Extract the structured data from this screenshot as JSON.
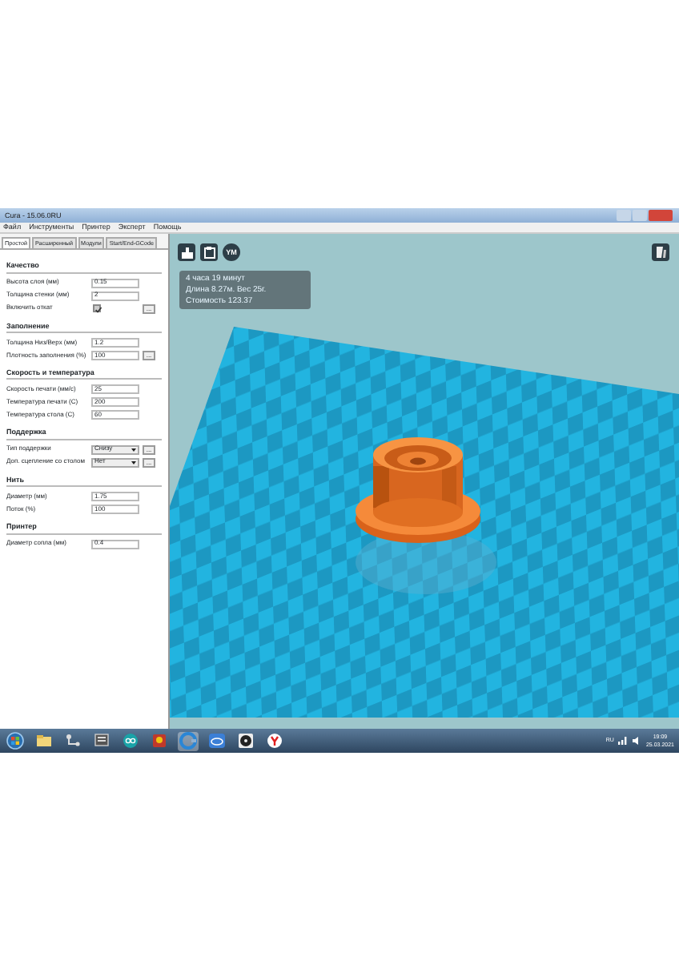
{
  "window": {
    "title": "Cura - 15.06.0RU"
  },
  "menu": [
    "Файл",
    "Инструменты",
    "Принтер",
    "Эксперт",
    "Помощь"
  ],
  "tabs": [
    {
      "label": "Простой",
      "selected": true
    },
    {
      "label": "Расширенный",
      "selected": false
    },
    {
      "label": "Модули",
      "selected": false
    },
    {
      "label": "Start/End-GCode",
      "selected": false
    }
  ],
  "sections": [
    {
      "title": "Качество",
      "fields": [
        {
          "kind": "text",
          "label": "Высота слоя (мм)",
          "value": "0.15"
        },
        {
          "kind": "text",
          "label": "Толщина стенки (мм)",
          "value": "2"
        },
        {
          "kind": "check",
          "label": "Включить откат",
          "checked": true,
          "button": "..."
        }
      ]
    },
    {
      "title": "Заполнение",
      "fields": [
        {
          "kind": "text",
          "label": "Толщина Низ/Верх (мм)",
          "value": "1.2"
        },
        {
          "kind": "text",
          "label": "Плотность заполнения (%)",
          "value": "100",
          "button": "..."
        }
      ]
    },
    {
      "title": "Скорость и температура",
      "fields": [
        {
          "kind": "text",
          "label": "Скорость печати (мм/с)",
          "value": "25"
        },
        {
          "kind": "text",
          "label": "Температура печати (C)",
          "value": "200"
        },
        {
          "kind": "text",
          "label": "Температура стола (C)",
          "value": "60"
        }
      ]
    },
    {
      "title": "Поддержка",
      "fields": [
        {
          "kind": "select",
          "label": "Тип поддержки",
          "value": "Снизу",
          "button": "..."
        },
        {
          "kind": "select",
          "label": "Доп. сцепление со столом",
          "value": "Нет",
          "button": "..."
        }
      ]
    },
    {
      "title": "Нить",
      "fields": [
        {
          "kind": "text",
          "label": "Диаметр (мм)",
          "value": "1.75"
        },
        {
          "kind": "text",
          "label": "Поток (%)",
          "value": "100"
        }
      ]
    },
    {
      "title": "Принтер",
      "fields": [
        {
          "kind": "text",
          "label": "Диаметр сопла (мм)",
          "value": "0.4"
        }
      ]
    }
  ],
  "viewport": {
    "view_mode_label": "YM",
    "stats": [
      "4 часа 19 минут",
      "Длина 8.27м. Вес 25г.",
      "Стоимость 123.37"
    ]
  },
  "taskbar": {
    "apps": [
      {
        "kind": "folder",
        "active": false
      },
      {
        "kind": "network",
        "active": false
      },
      {
        "kind": "monitor",
        "active": false
      },
      {
        "kind": "arduino",
        "active": false
      },
      {
        "kind": "game",
        "active": false
      },
      {
        "kind": "cura",
        "active": true
      },
      {
        "kind": "cloud",
        "active": false
      },
      {
        "kind": "disc",
        "active": false
      },
      {
        "kind": "browser",
        "active": false
      }
    ],
    "language": "RU",
    "time": "19:09",
    "date": "25.03.2021"
  }
}
